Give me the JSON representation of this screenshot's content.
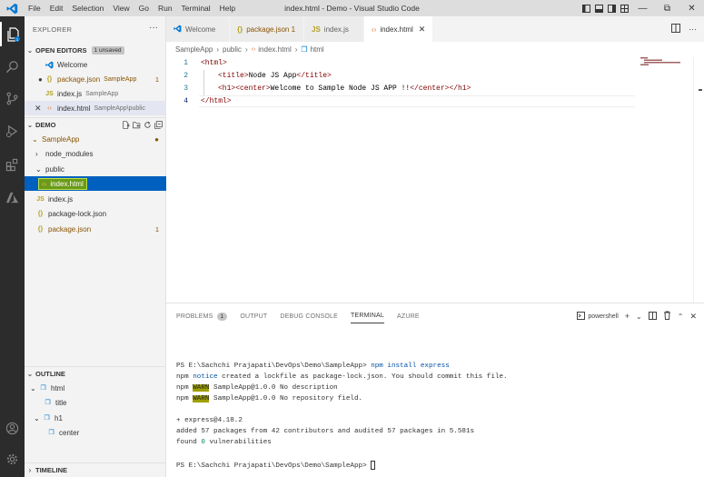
{
  "titlebar": {
    "window_title": "index.html - Demo - Visual Studio Code",
    "menu": [
      "File",
      "Edit",
      "Selection",
      "View",
      "Go",
      "Run",
      "Terminal",
      "Help"
    ]
  },
  "sidebar": {
    "title": "EXPLORER",
    "open_editors": {
      "label": "OPEN EDITORS",
      "badge": "1 unsaved",
      "items": [
        {
          "name": "Welcome",
          "path": ""
        },
        {
          "name": "package.json",
          "path": "SampleApp",
          "count": "1"
        },
        {
          "name": "index.js",
          "path": "SampleApp"
        },
        {
          "name": "index.html",
          "path": "SampleApp\\public"
        }
      ]
    },
    "workspace": {
      "label": "DEMO",
      "tree": [
        {
          "label": "SampleApp"
        },
        {
          "label": "node_modules"
        },
        {
          "label": "public"
        },
        {
          "label": "index.html"
        },
        {
          "label": "index.js"
        },
        {
          "label": "package-lock.json"
        },
        {
          "label": "package.json",
          "count": "1"
        }
      ]
    },
    "outline": {
      "label": "OUTLINE",
      "items": [
        "html",
        "title",
        "h1",
        "center"
      ]
    },
    "timeline": {
      "label": "TIMELINE"
    }
  },
  "tabs": [
    {
      "label": "Welcome",
      "active": false
    },
    {
      "label": "package.json 1",
      "active": false,
      "modified": true
    },
    {
      "label": "index.js",
      "active": false
    },
    {
      "label": "index.html",
      "active": true
    }
  ],
  "breadcrumb": [
    "SampleApp",
    "public",
    "index.html",
    "html"
  ],
  "editor": {
    "line_numbers": [
      "1",
      "2",
      "3",
      "4"
    ],
    "lines": [
      {
        "tag_open": "<html>"
      },
      {
        "t1": "<title>",
        "text": "Node JS App",
        "t2": "</title>"
      },
      {
        "t1": "<h1>",
        "t2": "<center>",
        "text": "Welcome to Sample Node JS APP !!",
        "t3": "</center>",
        "t4": "</h1>"
      },
      {
        "tag_close": "</html>"
      }
    ]
  },
  "panel": {
    "tabs": [
      "PROBLEMS",
      "OUTPUT",
      "DEBUG CONSOLE",
      "TERMINAL",
      "AZURE"
    ],
    "problems_count": "1",
    "shell": "powershell",
    "terminal": {
      "prompt": "PS E:\\Sachchi Prajapati\\DevOps\\Demo\\SampleApp>",
      "command": "npm install express",
      "l2_a": "npm",
      "l2_b": "notice",
      "l2_c": "created a lockfile as package-lock.json. You should commit this file.",
      "l3_a": "npm",
      "l3_b": "WARN",
      "l3_c": "SampleApp@1.0.0 No description",
      "l4_a": "npm",
      "l4_b": "WARN",
      "l4_c": "SampleApp@1.0.0 No repository field.",
      "l5": "+ express@4.18.2",
      "l6": "added 57 packages from 42 contributors and audited 57 packages in 5.581s",
      "l7_a": "found",
      "l7_b": "0",
      "l7_c": "vulnerabilities",
      "final_prompt": "PS E:\\Sachchi Prajapati\\DevOps\\Demo\\SampleApp>"
    }
  },
  "colors": {
    "accent": "#0060c0",
    "titlebar": "#dddddd",
    "activitybar": "#2c2c2c",
    "sidebar": "#f3f3f3",
    "tag": "#800000",
    "warn_bg": "#a0a000"
  }
}
